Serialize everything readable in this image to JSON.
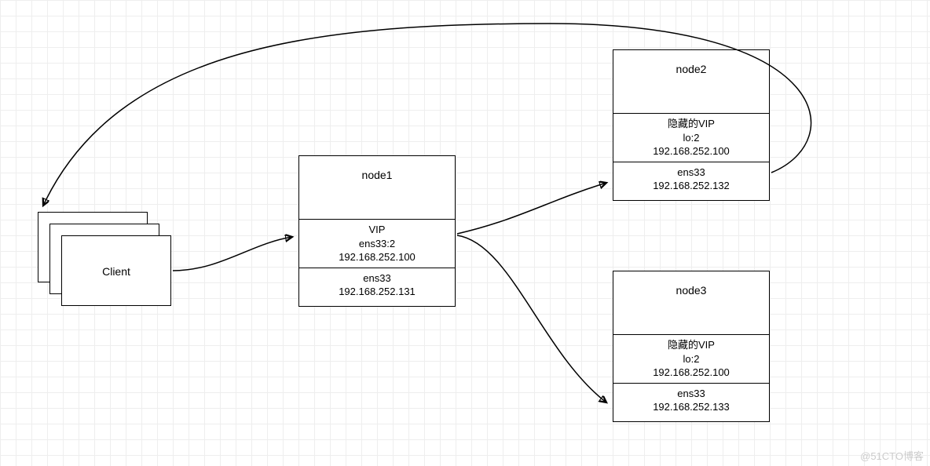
{
  "diagram": {
    "client": {
      "label": "Client"
    },
    "node1": {
      "title": "node1",
      "vip_label": "VIP",
      "vip_iface": "ens33:2",
      "vip_ip": "192.168.252.100",
      "iface": "ens33",
      "ip": "192.168.252.131"
    },
    "node2": {
      "title": "node2",
      "vip_label": "隐藏的VIP",
      "vip_iface": "lo:2",
      "vip_ip": "192.168.252.100",
      "iface": "ens33",
      "ip": "192.168.252.132"
    },
    "node3": {
      "title": "node3",
      "vip_label": "隐藏的VIP",
      "vip_iface": "lo:2",
      "vip_ip": "192.168.252.100",
      "iface": "ens33",
      "ip": "192.168.252.133"
    }
  },
  "watermark": "@51CTO博客"
}
